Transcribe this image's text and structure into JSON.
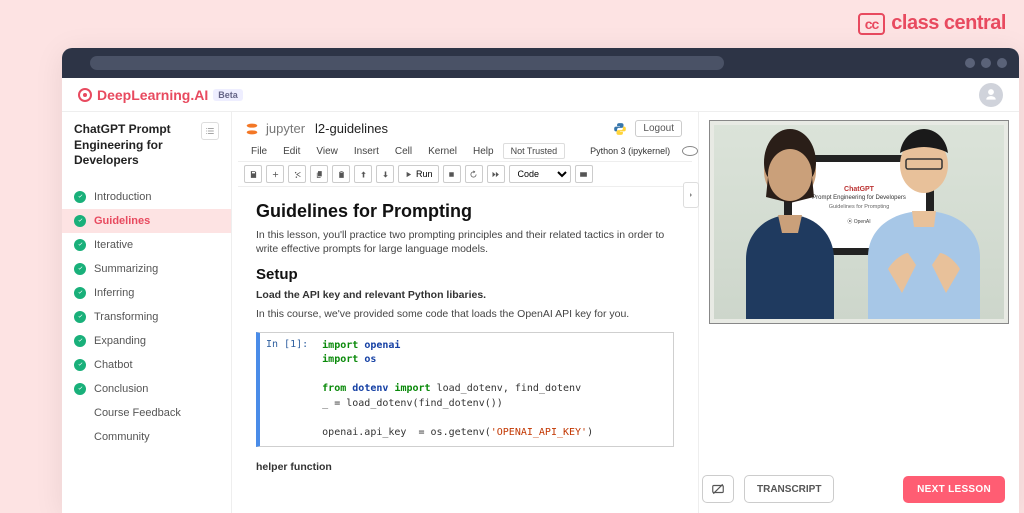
{
  "class_central": {
    "badge": "cc",
    "text": "class central"
  },
  "brand": {
    "name": "DeepLearning.AI",
    "badge": "Beta"
  },
  "course": {
    "title": "ChatGPT Prompt Engineering for Developers"
  },
  "sidebar": {
    "items": [
      {
        "label": "Introduction",
        "done": true
      },
      {
        "label": "Guidelines",
        "done": true,
        "active": true
      },
      {
        "label": "Iterative",
        "done": true
      },
      {
        "label": "Summarizing",
        "done": true
      },
      {
        "label": "Inferring",
        "done": true
      },
      {
        "label": "Transforming",
        "done": true
      },
      {
        "label": "Expanding",
        "done": true
      },
      {
        "label": "Chatbot",
        "done": true
      },
      {
        "label": "Conclusion",
        "done": true
      },
      {
        "label": "Course Feedback",
        "done": false
      },
      {
        "label": "Community",
        "done": false
      }
    ]
  },
  "jupyter": {
    "word": "jupyter",
    "notebook_name": "l2-guidelines",
    "logout": "Logout",
    "menu": [
      "File",
      "Edit",
      "View",
      "Insert",
      "Cell",
      "Kernel",
      "Help"
    ],
    "not_trusted": "Not Trusted",
    "kernel": "Python 3 (ipykernel)",
    "cell_type": "Code",
    "run_label": "Run"
  },
  "notebook": {
    "h1": "Guidelines for Prompting",
    "intro": "In this lesson, you'll practice two prompting principles and their related tactics in order to write effective prompts for large language models.",
    "h2": "Setup",
    "bold1": "Load the API key and relevant Python libaries.",
    "p2": "In this course, we've provided some code that loads the OpenAI API key for you.",
    "code_prompt": "In [1]:",
    "code": {
      "l1a": "import",
      "l1b": "openai",
      "l2a": "import",
      "l2b": "os",
      "l3a": "from",
      "l3b": "dotenv",
      "l3c": "import",
      "l3d": "load_dotenv, find_dotenv",
      "l4": "_ = load_dotenv(find_dotenv())",
      "l5a": "openai.api_key  = os.getenv(",
      "l5b": "'OPENAI_API_KEY'",
      "l5c": ")"
    },
    "bold2": "helper function"
  },
  "slide": {
    "line1": "ChatGPT",
    "line2": "Prompt Engineering for Developers",
    "line3": "Guidelines for Prompting",
    "line4": "⦿ OpenAI"
  },
  "controls": {
    "transcript": "TRANSCRIPT",
    "next": "NEXT LESSON"
  }
}
